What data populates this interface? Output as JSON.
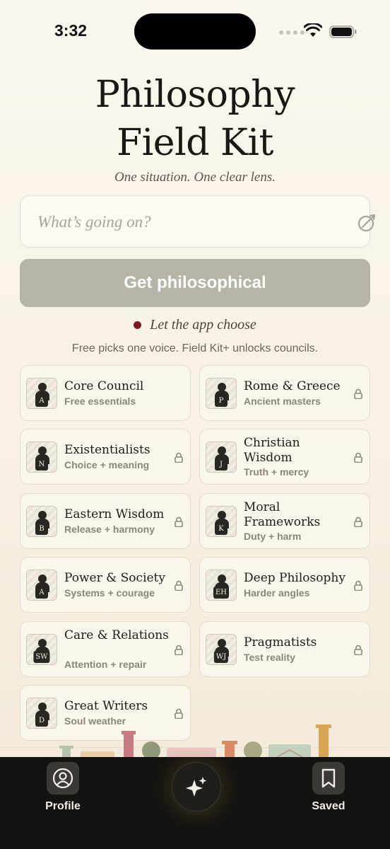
{
  "status_bar": {
    "time": "3:32"
  },
  "header": {
    "title_line1": "Philosophy",
    "title_line2": "Field Kit",
    "subtitle": "One situation. One clear lens."
  },
  "situation": {
    "placeholder": "What’s going on?",
    "value": ""
  },
  "primary_button": {
    "label": "Get philosophical"
  },
  "auto_choose": {
    "label": "Let the app choose",
    "dot_color": "#7a1a1a"
  },
  "free_note": "Free picks one voice. Field Kit+ unlocks councils.",
  "councils": [
    {
      "title": "Core Council",
      "subtitle": "Free essentials",
      "badge": "A",
      "locked": false
    },
    {
      "title": "Rome & Greece",
      "subtitle": "Ancient masters",
      "badge": "P",
      "locked": true
    },
    {
      "title": "Existentialists",
      "subtitle": "Choice + meaning",
      "badge": "N",
      "locked": true
    },
    {
      "title": "Christian Wisdom",
      "subtitle": "Truth + mercy",
      "badge": "J",
      "locked": true
    },
    {
      "title": "Eastern Wisdom",
      "subtitle": "Release + harmony",
      "badge": "B",
      "locked": true
    },
    {
      "title": "Moral Frameworks",
      "subtitle": "Duty + harm",
      "badge": "K",
      "locked": true
    },
    {
      "title": "Power & Society",
      "subtitle": "Systems + courage",
      "badge": "A",
      "locked": true
    },
    {
      "title": "Deep Philosophy",
      "subtitle": "Harder angles",
      "badge": "EH",
      "locked": true
    },
    {
      "title": "Care & Relations",
      "subtitle": "Attention + repair",
      "badge": "SW",
      "locked": true
    },
    {
      "title": "Pragmatists",
      "subtitle": "Test reality",
      "badge": "WJ",
      "locked": true
    },
    {
      "title": "Great Writers",
      "subtitle": "Soul weather",
      "badge": "D",
      "locked": true
    }
  ],
  "tab_bar": {
    "profile_label": "Profile",
    "saved_label": "Saved",
    "center_icon": "sparkles-icon"
  },
  "colors": {
    "button_disabled": "#b5b4a6",
    "tab_bar": "#141311",
    "card_bg": "#fbf6ec"
  }
}
